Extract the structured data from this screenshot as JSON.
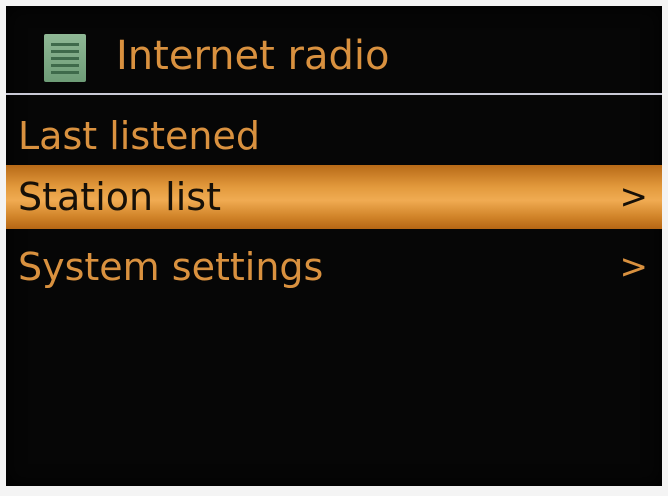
{
  "header": {
    "title": "Internet radio",
    "icon": "menu-list-icon"
  },
  "menu": {
    "items": [
      {
        "label": "Last listened",
        "arrow": "",
        "selected": false
      },
      {
        "label": "Station list",
        "arrow": ">",
        "selected": true
      },
      {
        "label": "System settings",
        "arrow": ">",
        "selected": false
      }
    ]
  },
  "colors": {
    "text": "#d9913f",
    "highlight": "#e39a3d",
    "background": "#060606",
    "icon": "#7fab86"
  }
}
